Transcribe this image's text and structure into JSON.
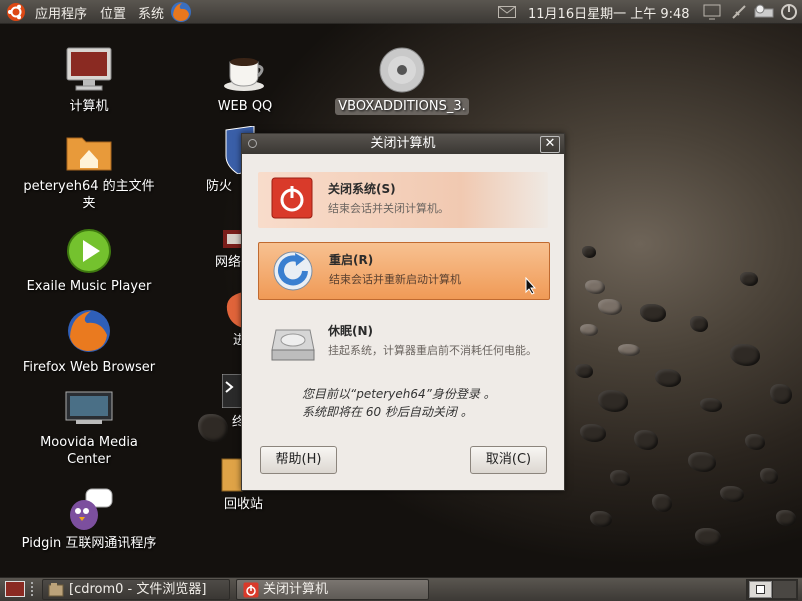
{
  "top_panel": {
    "menu_applications": "应用程序",
    "menu_places": "位置",
    "menu_system": "系统",
    "clock": "11月16日星期一 上午 9:48"
  },
  "desktop_icons": {
    "computer": "计算机",
    "webqq": "WEB QQ",
    "vboxadditions": "VBOXADDITIONS_3.",
    "home_line1": "peteryeh64 的主文件",
    "home_line2": "夹",
    "firewall": "防火",
    "network": "网络",
    "web": "进",
    "terminal": "终",
    "trash": "回收站",
    "exaile": "Exaile Music Player",
    "firefox": "Firefox Web Browser",
    "moovida_line1": "Moovida Media",
    "moovida_line2": "Center",
    "pidgin": "Pidgin 互联网通讯程序"
  },
  "dialog": {
    "title": "关闭计算机",
    "shutdown_title": "关闭系统(S)",
    "shutdown_desc": "结束会话并关闭计算机。",
    "restart_title": "重启(R)",
    "restart_desc": "结束会话并重新启动计算机",
    "hibernate_title": "休眠(N)",
    "hibernate_desc": "挂起系统，计算器重启前不消耗任何电能。",
    "login_info": "您目前以“peteryeh64”身份登录 。",
    "countdown": "系统即将在 60 秒后自动关闭 。",
    "help_button": "帮助(H)",
    "cancel_button": "取消(C)"
  },
  "taskbar": {
    "task1": "[cdrom0 - 文件浏览器]",
    "task2": "关闭计算机"
  },
  "colors": {
    "panel": "#4a4743",
    "dialog_bg": "#efebe7",
    "highlight": "#f2a15f",
    "shutdown_red": "#d93a2a"
  }
}
